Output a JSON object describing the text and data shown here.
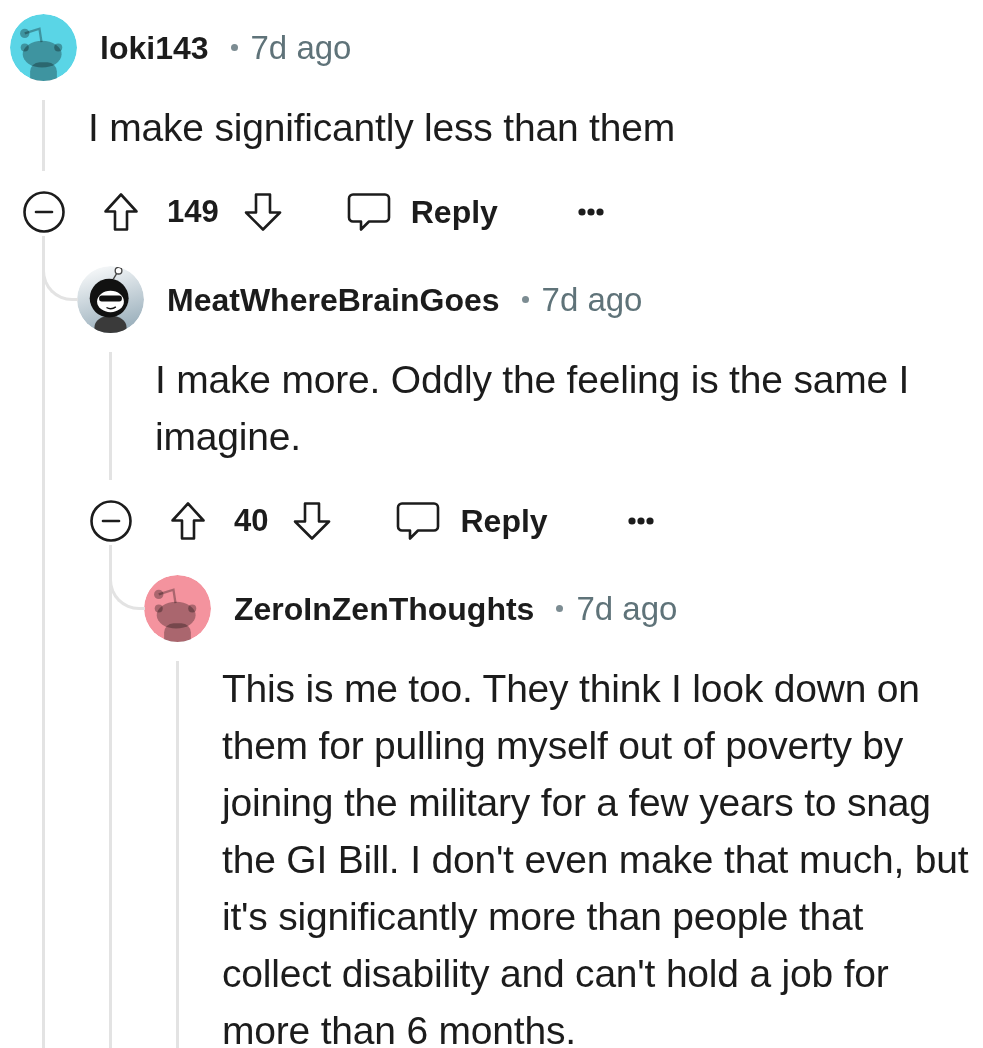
{
  "comments": [
    {
      "author": "loki143",
      "time": "7d ago",
      "avatar": {
        "kind": "snoo",
        "color": "#5ad5e6"
      },
      "body": "I make significantly less than them",
      "expanded": true,
      "score": "149",
      "reply_label": "Reply",
      "children": [
        {
          "author": "MeatWhereBrainGoes",
          "time": "7d ago",
          "avatar": {
            "kind": "custom"
          },
          "body": "I make more. Oddly the feeling is the same I\nimagine.",
          "expanded": true,
          "score": "40",
          "reply_label": "Reply",
          "children": [
            {
              "author": "ZeroInZenThoughts",
              "time": "7d ago",
              "avatar": {
                "kind": "snoo",
                "color": "#f4939e"
              },
              "body": "This is me too. They think I look down on them for pulling myself out of poverty by joining the military for a few years to snag the GI Bill. I don't even make that much, but it's significantly more than people that collect disability and can't hold a job for more than 6 months."
            }
          ]
        }
      ]
    }
  ]
}
